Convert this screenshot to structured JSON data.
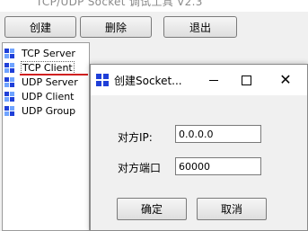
{
  "window": {
    "title": "TCP/UDP Socket 调试工具 V2.3"
  },
  "toolbar": {
    "create": "创建",
    "delete": "删除",
    "exit": "退出"
  },
  "tree": {
    "items": [
      {
        "label": "TCP Server",
        "selected": false
      },
      {
        "label": "TCP Client",
        "selected": true
      },
      {
        "label": "UDP Server",
        "selected": false
      },
      {
        "label": "UDP Client",
        "selected": false
      },
      {
        "label": "UDP Group",
        "selected": false
      }
    ]
  },
  "dialog": {
    "title": "创建Socket...",
    "ip_label": "对方IP:",
    "ip_value": "0.0.0.0",
    "port_label": "对方端口",
    "port_value": "60000",
    "ok": "确定",
    "cancel": "取消"
  },
  "colors": {
    "icon_blue": "#1f3fd8",
    "indicator_red": "#d02020"
  }
}
